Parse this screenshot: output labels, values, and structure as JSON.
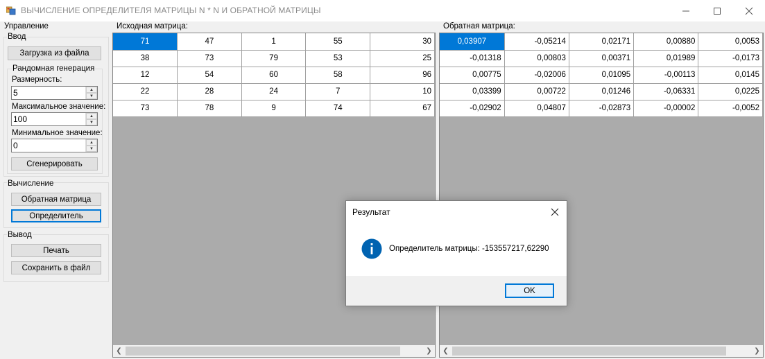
{
  "window": {
    "title": "ВЫЧИСЛЕНИЕ ОПРЕДЕЛИТЕЛЯ МАТРИЦЫ N * N И ОБРАТНОЙ МАТРИЦЫ",
    "controls": {
      "minimize": "—",
      "maximize": "☐",
      "close": "✕"
    }
  },
  "control_panel": {
    "title": "Управление",
    "input": {
      "title": "Ввод",
      "load_button": "Загрузка из файла",
      "random": {
        "title": "Рандомная генерация",
        "size_label": "Размерность:",
        "size_value": "5",
        "max_label": "Максимальное значение:",
        "max_value": "100",
        "min_label": "Минимальное значение:",
        "min_value": "0",
        "generate_button": "Сгенерировать"
      }
    },
    "compute": {
      "title": "Вычисление",
      "inverse_button": "Обратная матрица",
      "determinant_button": "Определитель"
    },
    "output": {
      "title": "Вывод",
      "print_button": "Печать",
      "save_button": "Сохранить в файл"
    }
  },
  "source_matrix": {
    "title": "Исходная матрица:",
    "rows": [
      [
        "71",
        "47",
        "1",
        "55",
        "30"
      ],
      [
        "38",
        "73",
        "79",
        "53",
        "25"
      ],
      [
        "12",
        "54",
        "60",
        "58",
        "96"
      ],
      [
        "22",
        "28",
        "24",
        "7",
        "10"
      ],
      [
        "73",
        "78",
        "9",
        "74",
        "67"
      ]
    ]
  },
  "inverse_matrix": {
    "title": "Обратная  матрица:",
    "rows": [
      [
        "0,03907",
        "-0,05214",
        "0,02171",
        "0,00880",
        "0,0053"
      ],
      [
        "-0,01318",
        "0,00803",
        "0,00371",
        "0,01989",
        "-0,0173"
      ],
      [
        "0,00775",
        "-0,02006",
        "0,01095",
        "-0,00113",
        "0,0145"
      ],
      [
        "0,03399",
        "0,00722",
        "0,01246",
        "-0,06331",
        "0,0225"
      ],
      [
        "-0,02902",
        "0,04807",
        "-0,02873",
        "-0,00002",
        "-0,0052"
      ]
    ]
  },
  "dialog": {
    "title": "Результат",
    "message": "Определитель матрицы: -153557217,62290",
    "ok_button": "OK",
    "icon": "info-icon",
    "close": "✕"
  },
  "colors": {
    "selection": "#0078d7",
    "grid_background": "#ababab",
    "info_icon": "#0063b1"
  }
}
